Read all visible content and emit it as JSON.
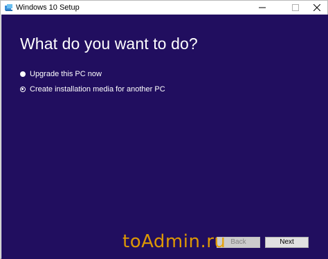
{
  "window": {
    "title": "Windows 10 Setup",
    "icon": "setup-app-icon",
    "controls": {
      "minimize": "minimize-icon",
      "maximize": "maximize-icon",
      "close": "close-icon"
    }
  },
  "main": {
    "heading": "What do you want to do?",
    "options": [
      {
        "label": "Upgrade this PC now",
        "selected": false
      },
      {
        "label": "Create installation media for another PC",
        "selected": true
      }
    ]
  },
  "footer": {
    "back_label": "Back",
    "back_enabled": false,
    "next_label": "Next"
  },
  "watermark": "toAdmin.ru",
  "colors": {
    "background": "#210e5f",
    "text": "#ffffff",
    "watermark": "#e8a000"
  }
}
